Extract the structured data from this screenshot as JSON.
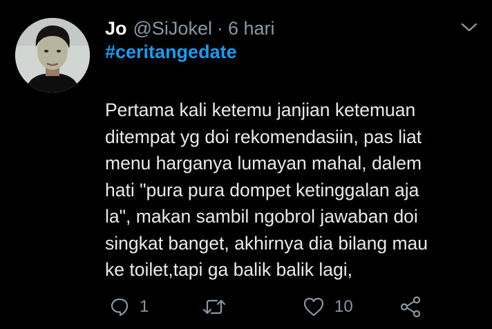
{
  "tweet": {
    "display_name": "Jo",
    "handle": "@SiJokel",
    "separator": "·",
    "time": "6 hari",
    "hashtag": "#ceritangedate",
    "body_lines": [
      "Pertama kali ketemu janjian ketemuan",
      "ditempat yg doi rekomendasiin, pas liat",
      "menu harganya lumayan mahal, dalem",
      "hati \"pura pura dompet ketinggalan aja",
      "la\", makan sambil ngobrol jawaban doi",
      "singkat banget, akhirnya dia bilang mau",
      "ke toilet,tapi ga balik balik lagi,"
    ]
  },
  "actions": {
    "reply": {
      "icon": "reply-icon",
      "count": "1"
    },
    "retweet": {
      "icon": "retweet-icon",
      "count": ""
    },
    "like": {
      "icon": "heart-icon",
      "count": "10"
    },
    "share": {
      "icon": "share-icon"
    }
  },
  "colors": {
    "background": "#000000",
    "text": "#e8eaed",
    "secondary": "#8b98a5",
    "link": "#1d9bf0"
  }
}
